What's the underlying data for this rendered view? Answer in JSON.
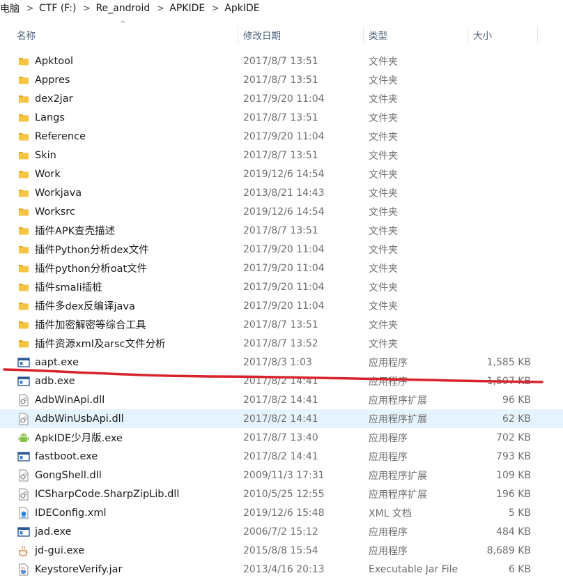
{
  "breadcrumb": {
    "items": [
      "电脑",
      "CTF (F:)",
      "Re_android",
      "APKIDE",
      "ApkIDE"
    ],
    "separator": ">"
  },
  "columns": {
    "name": "名称",
    "date": "修改日期",
    "type": "类型",
    "size": "大小"
  },
  "colors": {
    "folder": "#f5c542",
    "selected_row": "#e5f3ff",
    "annotation": "#d9232c"
  },
  "files": [
    {
      "name": "Apktool",
      "date": "2017/8/7 13:51",
      "type": "文件夹",
      "size": "",
      "icon": "folder-icon"
    },
    {
      "name": "Appres",
      "date": "2017/8/7 13:51",
      "type": "文件夹",
      "size": "",
      "icon": "folder-icon"
    },
    {
      "name": "dex2jar",
      "date": "2017/9/20 11:04",
      "type": "文件夹",
      "size": "",
      "icon": "folder-icon"
    },
    {
      "name": "Langs",
      "date": "2017/8/7 13:51",
      "type": "文件夹",
      "size": "",
      "icon": "folder-icon"
    },
    {
      "name": "Reference",
      "date": "2017/9/20 11:04",
      "type": "文件夹",
      "size": "",
      "icon": "folder-icon"
    },
    {
      "name": "Skin",
      "date": "2017/8/7 13:51",
      "type": "文件夹",
      "size": "",
      "icon": "folder-icon"
    },
    {
      "name": "Work",
      "date": "2019/12/6 14:54",
      "type": "文件夹",
      "size": "",
      "icon": "folder-icon"
    },
    {
      "name": "Workjava",
      "date": "2013/8/21 14:43",
      "type": "文件夹",
      "size": "",
      "icon": "folder-icon"
    },
    {
      "name": "Worksrc",
      "date": "2019/12/6 14:54",
      "type": "文件夹",
      "size": "",
      "icon": "folder-icon"
    },
    {
      "name": "插件APK查壳描述",
      "date": "2017/8/7 13:51",
      "type": "文件夹",
      "size": "",
      "icon": "folder-icon"
    },
    {
      "name": "插件Python分析dex文件",
      "date": "2017/9/20 11:04",
      "type": "文件夹",
      "size": "",
      "icon": "folder-icon"
    },
    {
      "name": "插件python分析oat文件",
      "date": "2017/9/20 11:04",
      "type": "文件夹",
      "size": "",
      "icon": "folder-icon"
    },
    {
      "name": "插件smali插桩",
      "date": "2017/9/20 11:04",
      "type": "文件夹",
      "size": "",
      "icon": "folder-icon"
    },
    {
      "name": "插件多dex反编译java",
      "date": "2017/9/20 11:04",
      "type": "文件夹",
      "size": "",
      "icon": "folder-icon"
    },
    {
      "name": "插件加密解密等综合工具",
      "date": "2017/8/7 13:51",
      "type": "文件夹",
      "size": "",
      "icon": "folder-icon"
    },
    {
      "name": "插件资源xml及arsc文件分析",
      "date": "2017/8/7 13:52",
      "type": "文件夹",
      "size": "",
      "icon": "folder-icon"
    },
    {
      "name": "aapt.exe",
      "date": "2017/8/3 1:03",
      "type": "应用程序",
      "size": "1,585 KB",
      "icon": "exe-icon"
    },
    {
      "name": "adb.exe",
      "date": "2017/8/2 14:41",
      "type": "应用程序",
      "size": "1,507 KB",
      "icon": "exe-icon"
    },
    {
      "name": "AdbWinApi.dll",
      "date": "2017/8/2 14:41",
      "type": "应用程序扩展",
      "size": "96 KB",
      "icon": "dll-icon"
    },
    {
      "name": "AdbWinUsbApi.dll",
      "date": "2017/8/2 14:41",
      "type": "应用程序扩展",
      "size": "62 KB",
      "icon": "dll-icon",
      "selected": true
    },
    {
      "name": "ApkIDE少月版.exe",
      "date": "2017/8/7 13:40",
      "type": "应用程序",
      "size": "702 KB",
      "icon": "android-icon"
    },
    {
      "name": "fastboot.exe",
      "date": "2017/8/2 14:41",
      "type": "应用程序",
      "size": "793 KB",
      "icon": "exe-icon"
    },
    {
      "name": "GongShell.dll",
      "date": "2009/11/3 17:31",
      "type": "应用程序扩展",
      "size": "109 KB",
      "icon": "dll-icon"
    },
    {
      "name": "ICSharpCode.SharpZipLib.dll",
      "date": "2010/5/25 12:55",
      "type": "应用程序扩展",
      "size": "196 KB",
      "icon": "dll-icon"
    },
    {
      "name": "IDEConfig.xml",
      "date": "2019/12/6 15:48",
      "type": "XML 文档",
      "size": "5 KB",
      "icon": "xml-icon"
    },
    {
      "name": "jad.exe",
      "date": "2006/7/2 15:12",
      "type": "应用程序",
      "size": "484 KB",
      "icon": "exe-icon"
    },
    {
      "name": "jd-gui.exe",
      "date": "2015/8/8 15:54",
      "type": "应用程序",
      "size": "8,689 KB",
      "icon": "java-icon"
    },
    {
      "name": "KeystoreVerify.jar",
      "date": "2013/4/16 20:13",
      "type": "Executable Jar File",
      "size": "6 KB",
      "icon": "jar-icon"
    }
  ]
}
